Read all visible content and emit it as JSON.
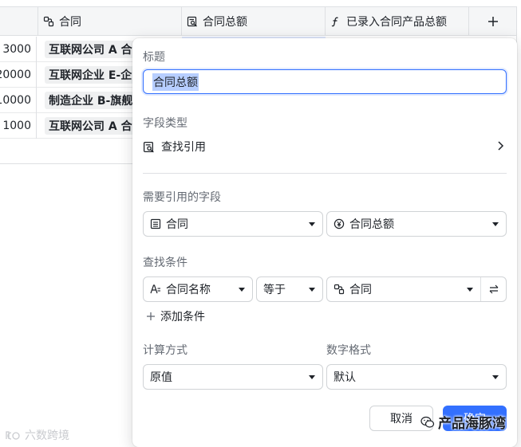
{
  "table": {
    "columns": [
      {
        "icon": "link-record-icon",
        "label": "合同"
      },
      {
        "icon": "lookup-icon",
        "label": "合同总额"
      },
      {
        "icon": "formula-icon",
        "label": "已录入合同产品总额"
      }
    ],
    "add_column_label": "+",
    "rows": [
      {
        "amount": "3000",
        "contract": "互联网公司 A 合"
      },
      {
        "amount": "20000",
        "contract": "互联网企业 E-企"
      },
      {
        "amount": "10000",
        "contract": "制造企业 B-旗舰"
      },
      {
        "amount": "1000",
        "contract": "互联网公司 A 合"
      }
    ]
  },
  "dialog": {
    "title_label": "标题",
    "title_value": "合同总额",
    "field_type_label": "字段类型",
    "field_type_value": "查找引用",
    "ref_field_label": "需要引用的字段",
    "ref_table": "合同",
    "ref_field": "合同总额",
    "condition_label": "查找条件",
    "cond_field": "合同名称",
    "cond_op": "等于",
    "cond_value": "合同",
    "add_condition": "添加条件",
    "calc_label": "计算方式",
    "calc_value": "原值",
    "format_label": "数字格式",
    "format_value": "默认",
    "cancel": "取消",
    "confirm": "确定"
  },
  "watermark": {
    "left": "六数跨境",
    "right": "产品海豚湾"
  },
  "colors": {
    "accent": "#3370ff",
    "border": "#d0d3d6",
    "tag_bg": "#eff0f1"
  }
}
